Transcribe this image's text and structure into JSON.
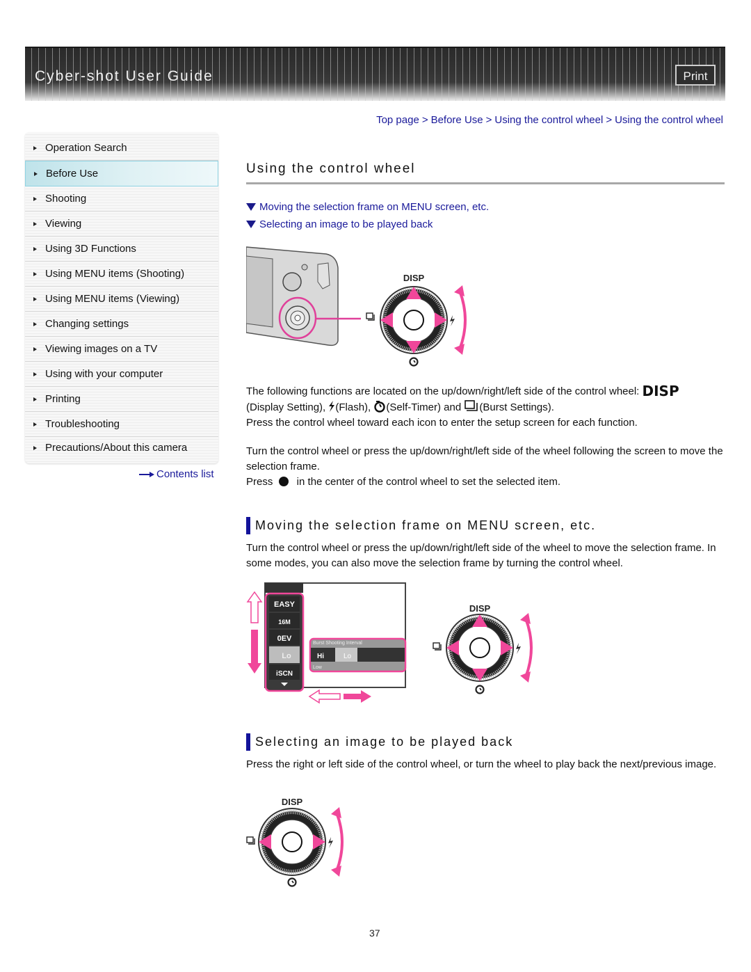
{
  "header": {
    "title": "Cyber-shot User Guide",
    "print_label": "Print"
  },
  "breadcrumb": {
    "items": [
      "Top page",
      "Before Use",
      "Using the control wheel",
      "Using the control wheel"
    ],
    "separator": ">"
  },
  "sidebar": {
    "items": [
      {
        "label": "Operation Search",
        "active": false
      },
      {
        "label": "Before Use",
        "active": true
      },
      {
        "label": "Shooting",
        "active": false
      },
      {
        "label": "Viewing",
        "active": false
      },
      {
        "label": "Using 3D Functions",
        "active": false
      },
      {
        "label": "Using MENU items (Shooting)",
        "active": false
      },
      {
        "label": "Using MENU items (Viewing)",
        "active": false
      },
      {
        "label": "Changing settings",
        "active": false
      },
      {
        "label": "Viewing images on a TV",
        "active": false
      },
      {
        "label": "Using with your computer",
        "active": false
      },
      {
        "label": "Printing",
        "active": false
      },
      {
        "label": "Troubleshooting",
        "active": false
      },
      {
        "label": "Precautions/About this camera",
        "active": false
      }
    ],
    "contents_list_label": "Contents list"
  },
  "main": {
    "title": "Using the control wheel",
    "jump_links": [
      "Moving the selection frame on MENU screen, etc.",
      "Selecting an image to be played back"
    ],
    "intro": {
      "line1_prefix": "The following functions are located on the up/down/right/left side of the control wheel: ",
      "disp_label": "DISP",
      "display_setting": "(Display Setting), ",
      "flash": "(Flash), ",
      "self_timer": "(Self-Timer) and ",
      "burst": "(Burst Settings).",
      "line3": "Press the control wheel toward each icon to enter the setup screen for each function.",
      "para2": "Turn the control wheel or press the up/down/right/left side of the wheel following the screen to move the selection frame.",
      "press_prefix": "Press ",
      "press_suffix": " in the center of the control wheel to set the selected item."
    },
    "sections": [
      {
        "heading": "Moving the selection frame on MENU screen, etc.",
        "body": "Turn the control wheel or press the up/down/right/left side of the wheel to move the selection frame. In some modes, you can also move the selection frame by turning the control wheel."
      },
      {
        "heading": "Selecting an image to be played back",
        "body": "Press the right or left side of the control wheel, or turn the wheel to play back the next/previous image."
      }
    ],
    "figures": {
      "wheel_label": "DISP",
      "menu_items": [
        "EASY",
        "16M",
        "0EV",
        "Lo",
        "iSCN"
      ],
      "burst_panel_title": "Burst Shooting Interval",
      "burst_options": [
        "Hi",
        "Lo"
      ],
      "burst_selected": "Low"
    }
  },
  "colors": {
    "link": "#1a1a9a",
    "accent_magenta": "#f0479a",
    "heading_bar": "#13139a",
    "active_nav": "#bfe3ea"
  },
  "page_number": "37"
}
